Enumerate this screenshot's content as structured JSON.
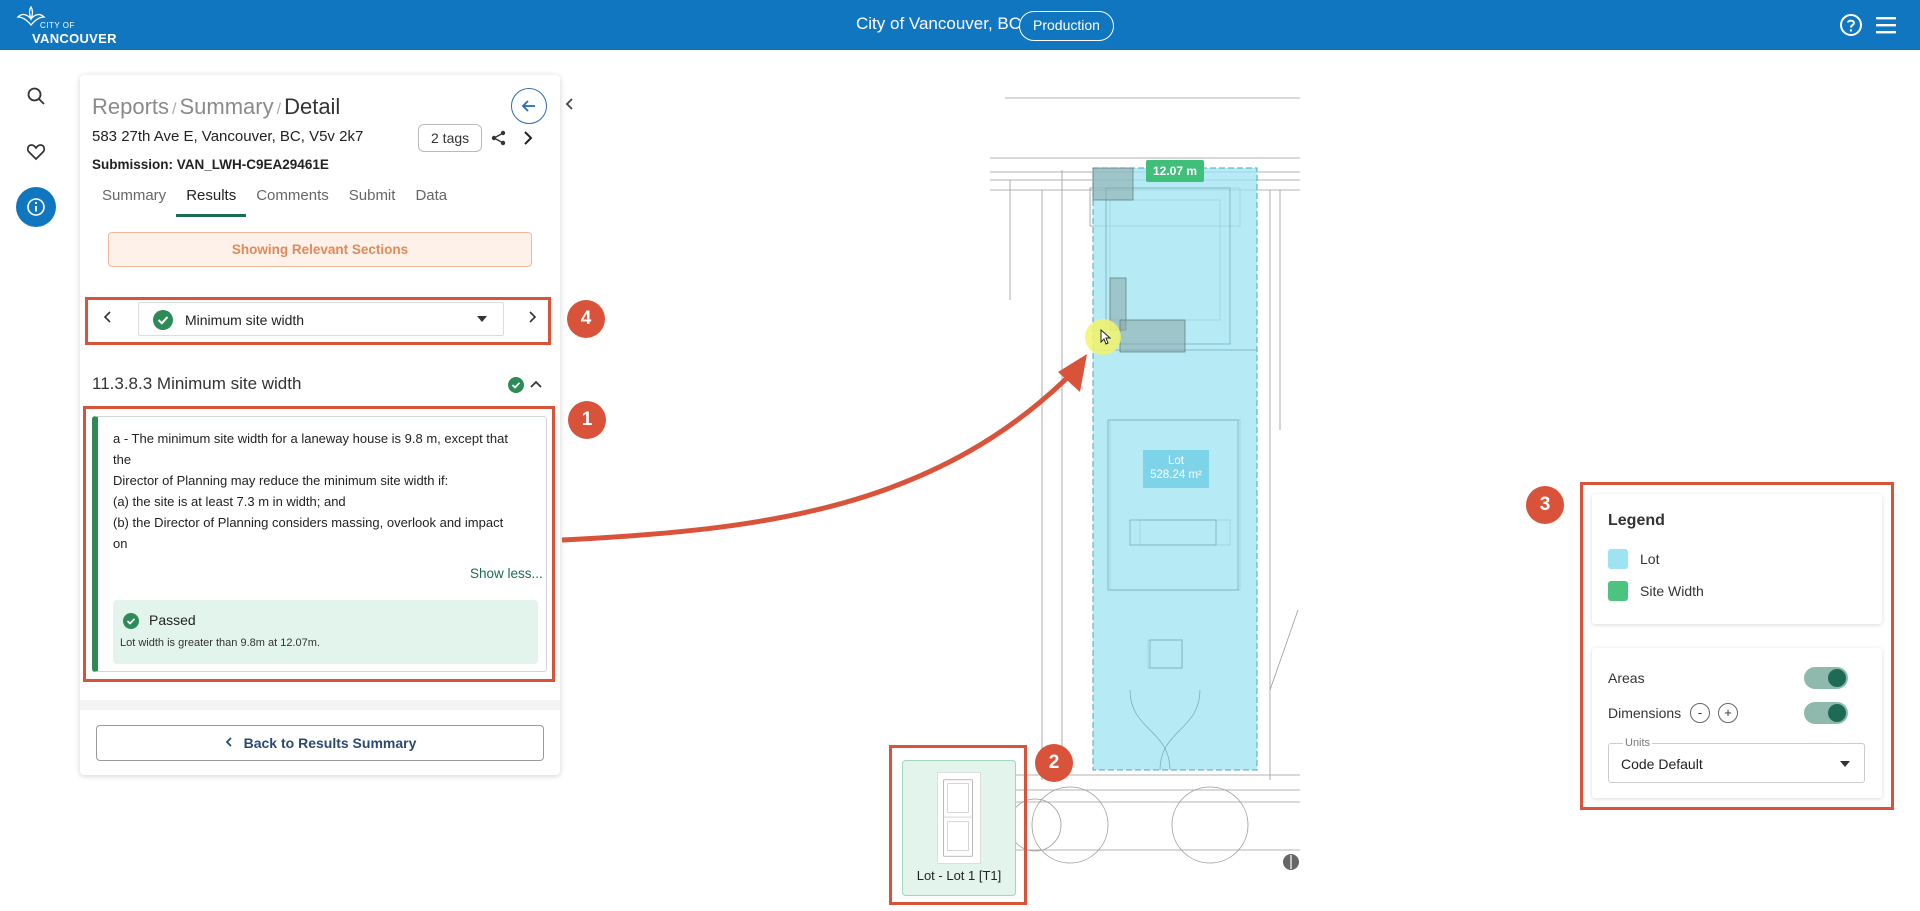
{
  "topbar": {
    "logo_small": "CITY OF",
    "logo_big": "VANCOUVER",
    "title": "City of Vancouver, BC",
    "environment": "Production",
    "bg_color": "#1176c0"
  },
  "rail": {
    "icons": [
      "search-icon",
      "heart-icon",
      "info-icon"
    ]
  },
  "panel": {
    "breadcrumb": {
      "item1": "Reports",
      "sep": "/",
      "item2": "Summary",
      "current": "Detail"
    },
    "address": "583 27th Ave E, Vancouver, BC, V5v 2k7",
    "tags_label": "2 tags",
    "submission_label": "Submission:",
    "submission_id": "VAN_LWH-C9EA29461E",
    "tabs": [
      "Summary",
      "Results",
      "Comments",
      "Submit",
      "Data"
    ],
    "active_tab": "Results",
    "relevant_banner": "Showing Relevant Sections",
    "selector_value": "Minimum site width",
    "section_title": "11.3.8.3 Minimum site width",
    "rule_lines": [
      "a - The minimum site width for a laneway house is 9.8 m, except that",
      "the",
      "Director of Planning may reduce the minimum site width if:",
      "(a) the site is at least 7.3 m in width; and",
      "(b) the Director of Planning considers massing, overlook and impact",
      "on"
    ],
    "show_less": "Show less...",
    "result_status": "Passed",
    "result_desc": "Lot width is greater than 9.8m at 12.07m.",
    "back_button": "Back to Results Summary"
  },
  "badges": [
    "1",
    "2",
    "3",
    "4"
  ],
  "drawing": {
    "site_width_label": "12.07 m",
    "lot_label": "Lot",
    "lot_area": "528.24 m²"
  },
  "thumbnail": {
    "label": "Lot - Lot 1 [T1]"
  },
  "legend": {
    "title": "Legend",
    "items": [
      {
        "label": "Lot",
        "color": "#9ee3f2"
      },
      {
        "label": "Site Width",
        "color": "#4cc47f"
      }
    ],
    "areas_label": "Areas",
    "areas_on": true,
    "dimensions_label": "Dimensions",
    "dimensions_on": true,
    "minus_label": "-",
    "plus_label": "+",
    "units_label": "Units",
    "units_value": "Code Default"
  }
}
